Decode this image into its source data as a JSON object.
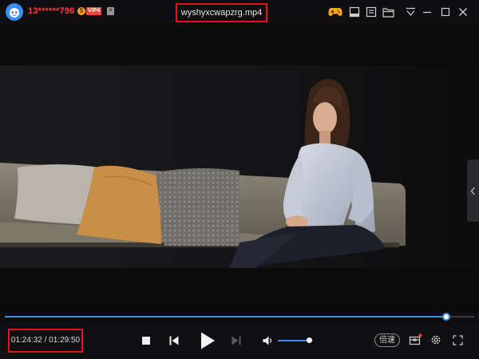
{
  "header": {
    "username": "13******796",
    "vip_coin": "$",
    "vip_label": "VIP4",
    "vip_extra": "✕",
    "file_title": "wyshyxcwapzrg.mp4",
    "icons": [
      "gamepad-icon",
      "mini-mode-icon",
      "playlist-icon",
      "folder-icon",
      "menu-icon",
      "minimize-icon",
      "maximize-icon",
      "close-icon"
    ]
  },
  "playback": {
    "current_time": "01:24:32",
    "separator": "/",
    "total_time": "01:29:50",
    "progress_fraction": 0.941,
    "volume_fraction": 0.88
  },
  "controls": {
    "speed_label": "倍速",
    "icons": [
      "stop-icon",
      "previous-icon",
      "play-icon",
      "next-icon",
      "volume-icon",
      "toolbox-icon",
      "settings-icon",
      "fullscreen-icon"
    ]
  },
  "colors": {
    "accent": "#3d8dea",
    "highlight_border": "#e3141b",
    "username": "#ff3b3b"
  }
}
